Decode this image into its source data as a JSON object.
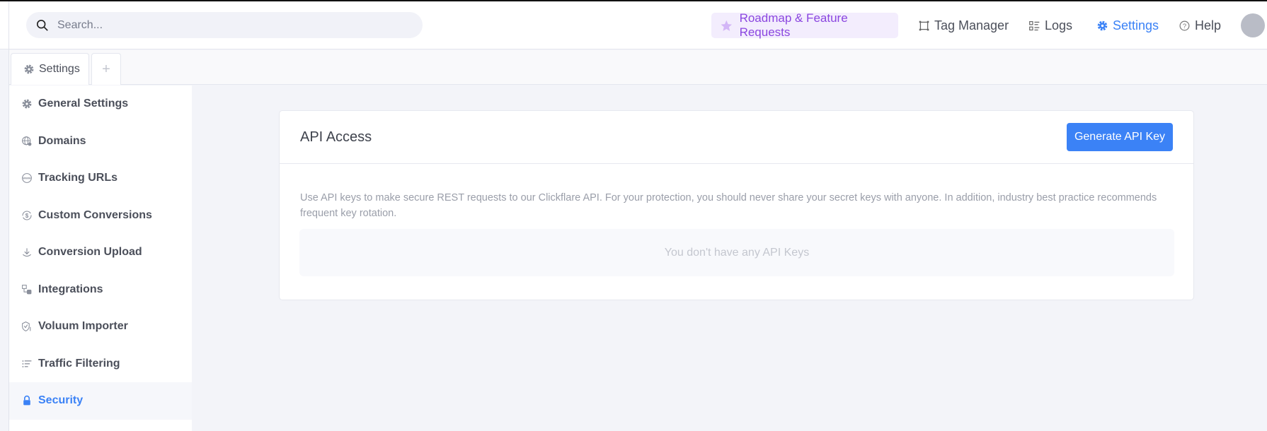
{
  "topbar": {
    "search_placeholder": "Search...",
    "roadmap_label": "Roadmap & Feature Requests",
    "nav": {
      "tag_manager": "Tag Manager",
      "logs": "Logs",
      "settings": "Settings",
      "help": "Help"
    }
  },
  "tabs": {
    "settings": "Settings",
    "add": "+"
  },
  "sidebar": {
    "items": [
      {
        "label": "General Settings",
        "icon": "gear-icon"
      },
      {
        "label": "Domains",
        "icon": "globe-icon"
      },
      {
        "label": "Tracking URLs",
        "icon": "www-icon"
      },
      {
        "label": "Custom Conversions",
        "icon": "dollar-cycle-icon"
      },
      {
        "label": "Conversion Upload",
        "icon": "download-icon"
      },
      {
        "label": "Integrations",
        "icon": "integrations-icon"
      },
      {
        "label": "Voluum Importer",
        "icon": "shield-import-icon"
      },
      {
        "label": "Traffic Filtering",
        "icon": "filter-list-icon"
      },
      {
        "label": "Security",
        "icon": "lock-icon"
      }
    ]
  },
  "card": {
    "title": "API Access",
    "generate_button": "Generate API Key",
    "description": "Use API keys to make secure REST requests to our Clickflare API. For your protection, you should never share your secret keys with anyone. In addition, industry best practice recommends frequent key rotation.",
    "empty_text": "You don't have any API Keys"
  },
  "colors": {
    "accent": "#3b82f6",
    "roadmap": "#8b46e0"
  }
}
